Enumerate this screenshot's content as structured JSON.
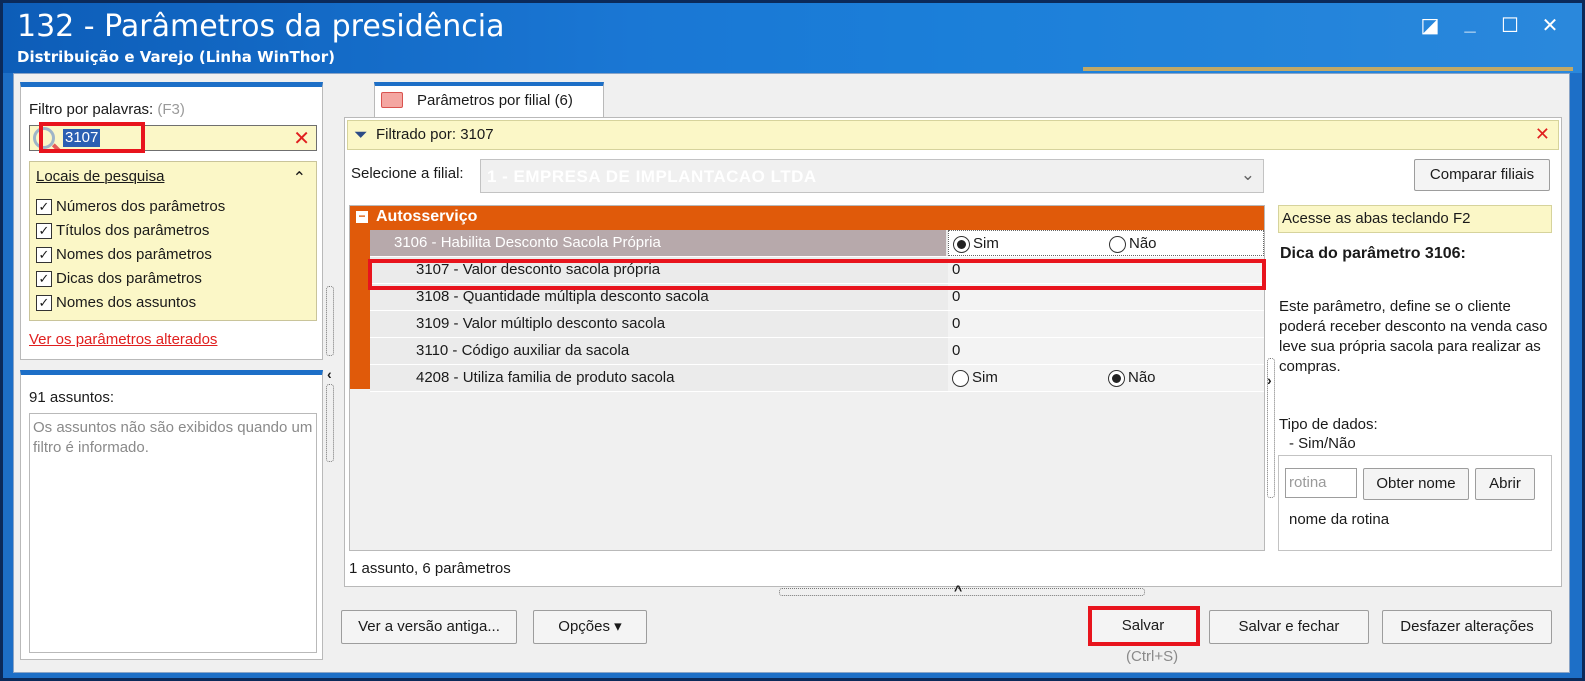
{
  "window": {
    "title": "132 - Parâmetros da presidência",
    "subtitle": "Distribuição e Varejo (Linha WinThor)",
    "controls": [
      "restore-icon",
      "minimize-icon",
      "maximize-icon",
      "close-icon"
    ]
  },
  "filter": {
    "label": "Filtro por palavras:",
    "hint": "(F3)",
    "value": "3107",
    "locais_title": "Locais de pesquisa",
    "checkboxes": [
      {
        "label": "Números dos parâmetros",
        "checked": true
      },
      {
        "label": "Títulos dos parâmetros",
        "checked": true
      },
      {
        "label": "Nomes dos parâmetros",
        "checked": true
      },
      {
        "label": "Dicas dos parâmetros",
        "checked": true
      },
      {
        "label": "Nomes dos assuntos",
        "checked": true
      }
    ],
    "changed_link": "Ver os parâmetros alterados"
  },
  "assuntos": {
    "count_label": "91 assuntos:",
    "message": "Os assuntos não são exibidos quando um filtro é informado."
  },
  "tab": {
    "label": "Parâmetros por filial",
    "count": "(6)"
  },
  "filterbar": {
    "text": "Filtrado por: 3107"
  },
  "filial": {
    "label": "Selecione a filial:",
    "value": "1 - EMPRESA DE IMPLANTACAO LTDA",
    "compare_button": "Comparar filiais"
  },
  "grid": {
    "group": "Autosserviço",
    "rows": [
      {
        "name": "3106 - Habilita Desconto Sacola Própria",
        "type": "radio",
        "selected": "Sim"
      },
      {
        "name": "3107 - Valor desconto sacola própria",
        "type": "value",
        "value": "0"
      },
      {
        "name": "3108 - Quantidade múltipla desconto sacola",
        "type": "value",
        "value": "0"
      },
      {
        "name": "3109 - Valor múltiplo desconto sacola",
        "type": "value",
        "value": "0"
      },
      {
        "name": "3110 - Código auxiliar da sacola",
        "type": "value",
        "value": "0"
      },
      {
        "name": "4208 - Utiliza familia de produto sacola",
        "type": "radio",
        "selected": "Não"
      }
    ],
    "radio_yes": "Sim",
    "radio_no": "Não",
    "footer": "1 assunto, 6 parâmetros"
  },
  "side": {
    "f2_hint": "Acesse as abas teclando F2",
    "dica_title": "Dica do parâmetro 3106:",
    "dica_text": "Este parâmetro, define se o cliente poderá receber desconto na venda caso leve sua própria sacola para realizar as compras.",
    "tipo_label": "Tipo de dados:",
    "tipo_value": "- Sim/Não",
    "rotina_placeholder": "rotina",
    "obter_nome": "Obter nome",
    "abrir": "Abrir",
    "nome_rotina": "nome da rotina"
  },
  "buttons": {
    "versao_antiga": "Ver a versão antiga...",
    "opcoes": "Opções",
    "salvar": "Salvar",
    "salvar_shortcut": "(Ctrl+S)",
    "salvar_fechar": "Salvar e fechar",
    "desfazer": "Desfazer alterações"
  }
}
